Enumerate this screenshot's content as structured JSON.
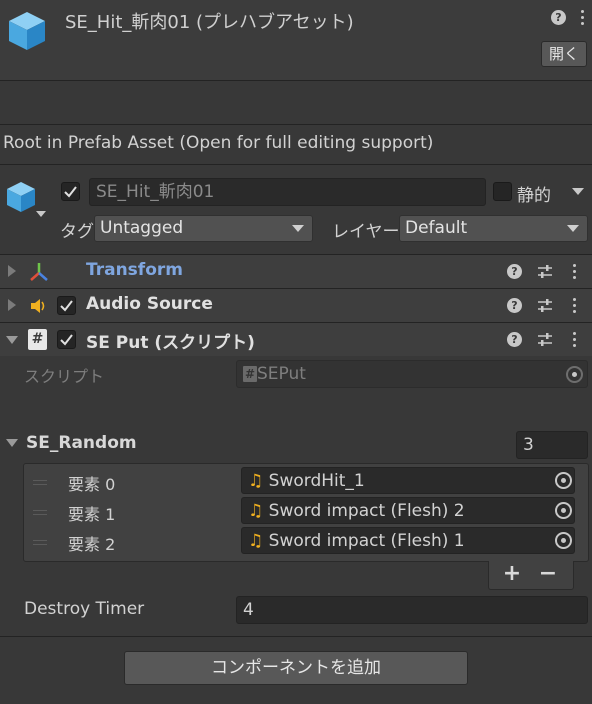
{
  "header": {
    "asset_title": "SE_Hit_斬肉01 (プレハブアセット)",
    "open_button": "開く",
    "help_icon": "?"
  },
  "prefab_notice": "Root in Prefab Asset (Open for full editing support)",
  "gameobject": {
    "name": "SE_Hit_斬肉01",
    "active": true,
    "static_label": "静的",
    "static": false,
    "tag_label": "タグ",
    "tag_value": "Untagged",
    "layer_label": "レイヤー",
    "layer_value": "Default"
  },
  "components": [
    {
      "name": "Transform",
      "icon": "transform-icon",
      "has_checkbox": false,
      "expanded": false
    },
    {
      "name": "Audio Source",
      "icon": "audio-source-icon",
      "has_checkbox": true,
      "expanded": false
    },
    {
      "name": "SE Put (スクリプト)",
      "icon": "script-icon",
      "has_checkbox": true,
      "expanded": true
    }
  ],
  "se_put": {
    "script_label": "スクリプト",
    "script_value": "SEPut",
    "script_icon": "#",
    "list_label": "SE_Random",
    "list_size": "3",
    "elements": [
      {
        "label": "要素 0",
        "value": "SwordHit_1"
      },
      {
        "label": "要素 1",
        "value": "Sword impact (Flesh) 2"
      },
      {
        "label": "要素 2",
        "value": "Sword impact (Flesh) 1"
      }
    ],
    "add_symbol": "+",
    "remove_symbol": "−",
    "destroy_timer_label": "Destroy Timer",
    "destroy_timer_value": "4"
  },
  "add_component_button": "コンポーネントを追加",
  "colors": {
    "background": "#383838",
    "transform_label": "#7fa6e0",
    "audio_icon": "#f0b020"
  }
}
